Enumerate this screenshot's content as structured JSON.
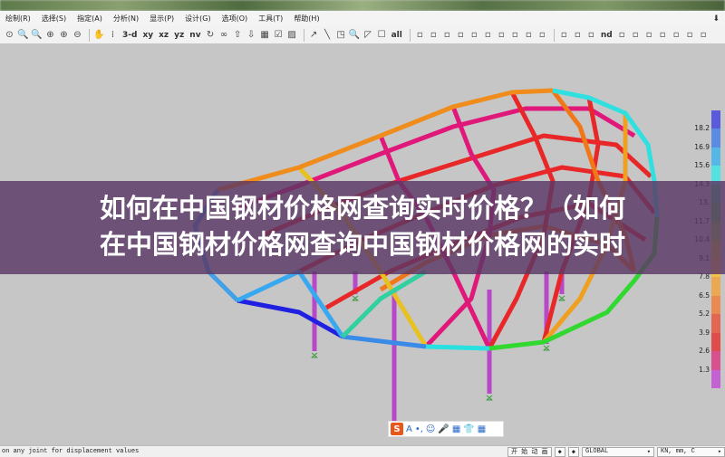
{
  "menu": [
    "绘制(R)",
    "选择(S)",
    "指定(A)",
    "分析(N)",
    "显示(P)",
    "设计(G)",
    "选项(O)",
    "工具(T)",
    "帮助(H)"
  ],
  "toolbar": {
    "view_labels": {
      "three_d": "3-d",
      "xy": "xy",
      "xz": "xz",
      "yz": "yz",
      "nv": "nv",
      "nd": "nd"
    },
    "icons": [
      "run-icon",
      "zoom-window-icon",
      "zoom-restore-icon",
      "zoom-in-icon",
      "zoom-in-step-icon",
      "zoom-out-icon",
      "pan-icon",
      "grid-icon",
      "rotate-icon",
      "glasses-icon",
      "up-icon",
      "down-icon",
      "layers-icon",
      "checkbox-icon",
      "options-icon"
    ],
    "select_icons": [
      "select-pointer-icon",
      "select-line-icon",
      "select-box-icon",
      "select-zoom-icon",
      "select-prev-icon",
      "select-all-icon"
    ],
    "select_all_label": "all",
    "download_icon": "download-icon"
  },
  "legend": {
    "labels": [
      "18.2",
      "16.9",
      "15.6",
      "14.3",
      "13.",
      "11.7",
      "10.4",
      "9.1",
      "7.8",
      "6.5",
      "5.2",
      "3.9",
      "2.6",
      "1.3"
    ],
    "colors": [
      "#5a5adc",
      "#5b8ce2",
      "#56b6e6",
      "#52e2e2",
      "#3ad898",
      "#48d050",
      "#8ad038",
      "#d2d030",
      "#f0c444",
      "#eaa852",
      "#e88a52",
      "#e26652",
      "#de4c4c",
      "#d8508e",
      "#c462d4"
    ]
  },
  "overlay": {
    "line1": "如何在中国钢材价格网查询实时价格？（如何",
    "line2": "在中国钢材价格网查询中国钢材价格网的实时"
  },
  "ime": {
    "logo": "S",
    "items": [
      "A",
      "•,",
      "☺",
      "🎤",
      "▦",
      "👕",
      "▦"
    ]
  },
  "status": {
    "message": "on any joint for displacement values",
    "animate": "开 始 动 画",
    "prev": "◆",
    "next": "◆",
    "coord_system": "GLOBAL",
    "units": "KN, mm, C"
  }
}
